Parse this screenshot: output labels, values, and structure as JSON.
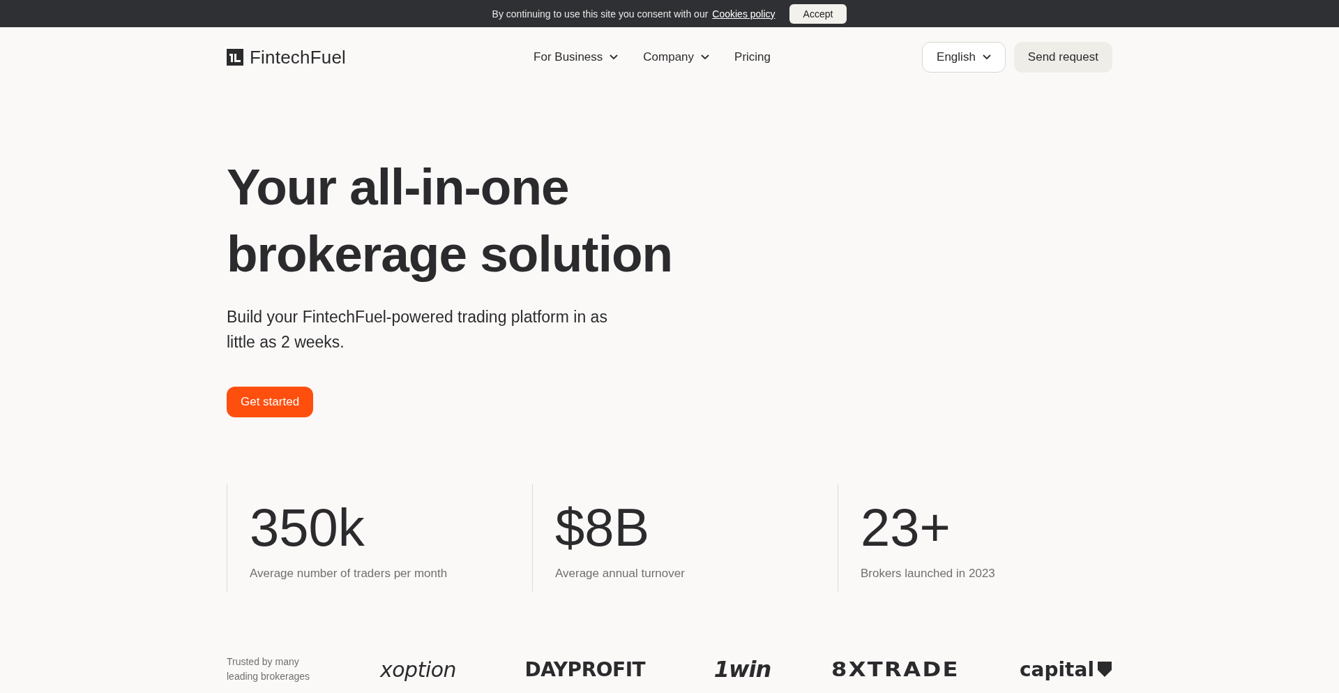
{
  "cookie_bar": {
    "text": "By continuing to use this site you consent with our",
    "link": "Cookies policy",
    "button": "Accept"
  },
  "header": {
    "logo": "FintechFuel",
    "nav": [
      {
        "label": "For Business",
        "dropdown": true
      },
      {
        "label": "Company",
        "dropdown": true
      },
      {
        "label": "Pricing",
        "dropdown": false
      }
    ],
    "language": "English",
    "cta": "Send request"
  },
  "hero": {
    "title_lines": [
      "Your all-in-one",
      "brokerage solution"
    ],
    "subtitle": "Build your FintechFuel-powered trading platform in as little as 2 weeks.",
    "button": "Get started"
  },
  "stats": [
    {
      "value": "350k",
      "label": "Average number of traders per month"
    },
    {
      "value": "$8B",
      "label": "Average annual turnover"
    },
    {
      "value": "23+",
      "label": "Brokers launched in 2023"
    }
  ],
  "trusted": {
    "label": "Trusted by many leading brokerages",
    "logos": [
      {
        "name": "xoption",
        "kind": "italic"
      },
      {
        "name": "DAYPROFIT",
        "kind": "caps"
      },
      {
        "name": "1win",
        "kind": "heavy"
      },
      {
        "name": "8XTRADE",
        "kind": "wide"
      },
      {
        "name": "capital",
        "kind": "mark"
      }
    ]
  }
}
